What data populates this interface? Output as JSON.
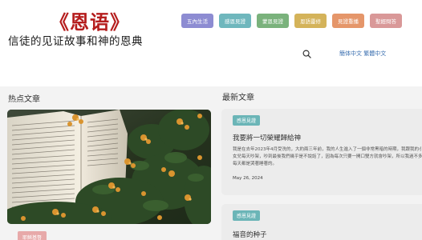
{
  "brand": {
    "title": "《恩语》",
    "subtitle": "信徒的见证故事和神的恩典"
  },
  "nav": [
    {
      "label": "五內生活",
      "color": "#8d8cd2"
    },
    {
      "label": "感恩見證",
      "color": "#6fb7bd"
    },
    {
      "label": "蒙恩見證",
      "color": "#7ab27c"
    },
    {
      "label": "恩語靈修",
      "color": "#d4b35a"
    },
    {
      "label": "見證重播",
      "color": "#e5966a"
    },
    {
      "label": "聖經問答",
      "color": "#d99898"
    }
  ],
  "language": {
    "text": "簡体中文 繁體中文"
  },
  "sections": {
    "hot": "热点文章",
    "new": "最新文章"
  },
  "featured": {
    "tag": "耶穌基督"
  },
  "articles": [
    {
      "tag": "感恩見證",
      "title": "我要將一切榮耀歸給神",
      "body": "我是在去年2023年4月受洗的，大約兩三年前，我的人生進入了一個非常黑暗的時期，我跟我的小女兒每天吵架，吵到最後我們幾乎是不說話了，因為每次只要一開口雙方就會吵架，所以我過不多每天都是哭著睡著的。",
      "date": "May 26, 2024"
    },
    {
      "tag": "感恩見證",
      "title": "福音的种子"
    }
  ]
}
